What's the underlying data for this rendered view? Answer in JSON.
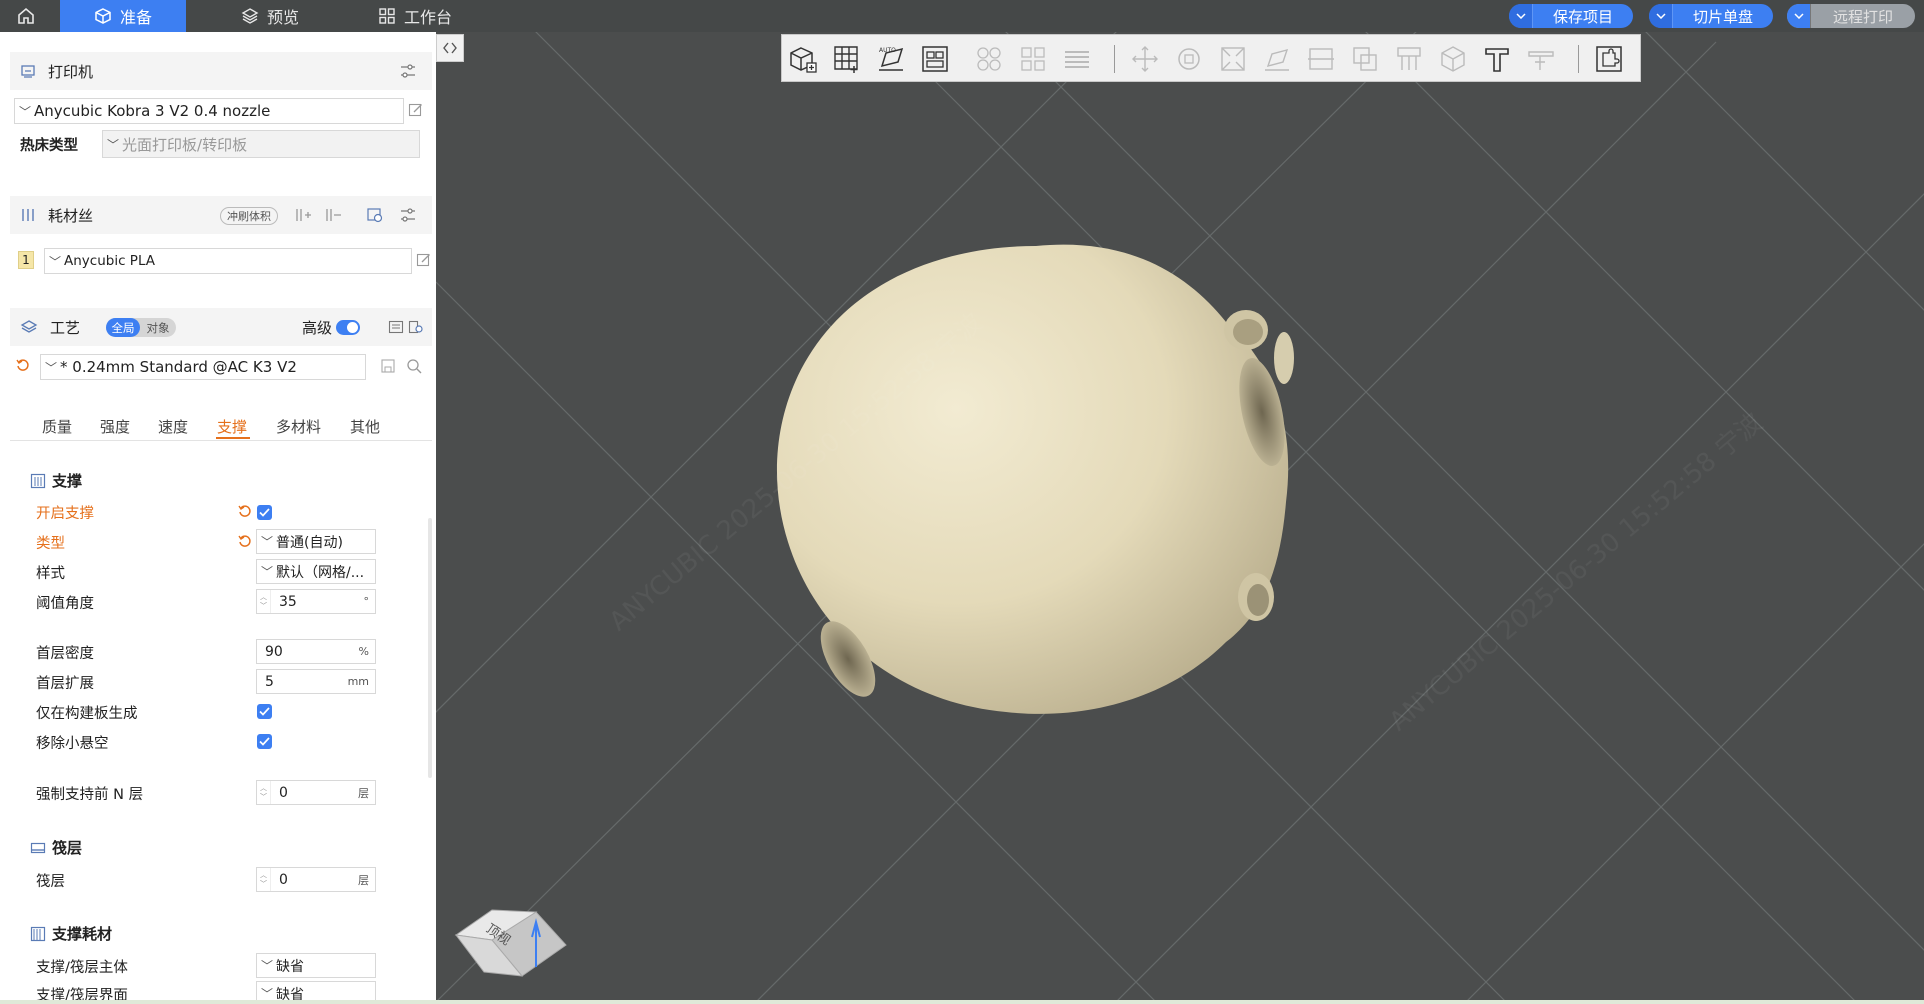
{
  "topbar": {
    "tabs": [
      {
        "label": "准备",
        "icon": "cube-icon",
        "active": true
      },
      {
        "label": "预览",
        "icon": "layers-icon",
        "active": false
      },
      {
        "label": "工作台",
        "icon": "grid-icon",
        "active": false
      }
    ],
    "buttons": {
      "save_project": "保存项目",
      "slice_plate": "切片单盘",
      "remote_print": "远程打印"
    },
    "accent": "#3d7ff2"
  },
  "printer": {
    "section_title": "打印机",
    "selected": "Anycubic Kobra 3 V2 0.4 nozzle",
    "bed_type_label": "热床类型",
    "bed_type_value": "光面打印板/转印板"
  },
  "filament": {
    "section_title": "耗材丝",
    "flush_volume_button": "冲刷体积",
    "slots": [
      {
        "index": "1",
        "name": "Anycubic PLA",
        "color": "#f5e6a8"
      }
    ]
  },
  "process": {
    "section_title": "工艺",
    "scope_global": "全局",
    "scope_object": "对象",
    "advanced_label": "高级",
    "advanced_on": true,
    "preset": "* 0.24mm Standard @AC K3 V2",
    "tabs": [
      "质量",
      "强度",
      "速度",
      "支撑",
      "多材料",
      "其他"
    ],
    "active_tab": "支撑",
    "support": {
      "group_title": "支撑",
      "enable_label": "开启支撑",
      "enable_value": true,
      "type_label": "类型",
      "type_value": "普通(自动)",
      "style_label": "样式",
      "style_value": "默认（网格/...",
      "threshold_label": "阈值角度",
      "threshold_value": "35",
      "threshold_unit": "°",
      "first_layer_density_label": "首层密度",
      "first_layer_density_value": "90",
      "first_layer_density_unit": "%",
      "first_layer_expand_label": "首层扩展",
      "first_layer_expand_value": "5",
      "first_layer_expand_unit": "mm",
      "on_build_plate_label": "仅在构建板生成",
      "on_build_plate_value": true,
      "remove_small_label": "移除小悬空",
      "remove_small_value": true,
      "enforce_layers_label": "强制支持前 N 层",
      "enforce_layers_value": "0",
      "enforce_layers_unit": "层"
    },
    "raft": {
      "group_title": "筏层",
      "raft_label": "筏层",
      "raft_value": "0",
      "raft_unit": "层"
    },
    "support_filament": {
      "group_title": "支撑耗材",
      "base_label": "支撑/筏层主体",
      "base_value": "缺省",
      "interface_label": "支撑/筏层界面",
      "interface_value": "缺省"
    }
  },
  "viewport": {
    "background": "#4b4d4d",
    "model_color": "#e6dcbd",
    "cube_label": "顶视",
    "watermark": "ANYCUBIC 2025-06-30 15:52:58 宁波"
  }
}
